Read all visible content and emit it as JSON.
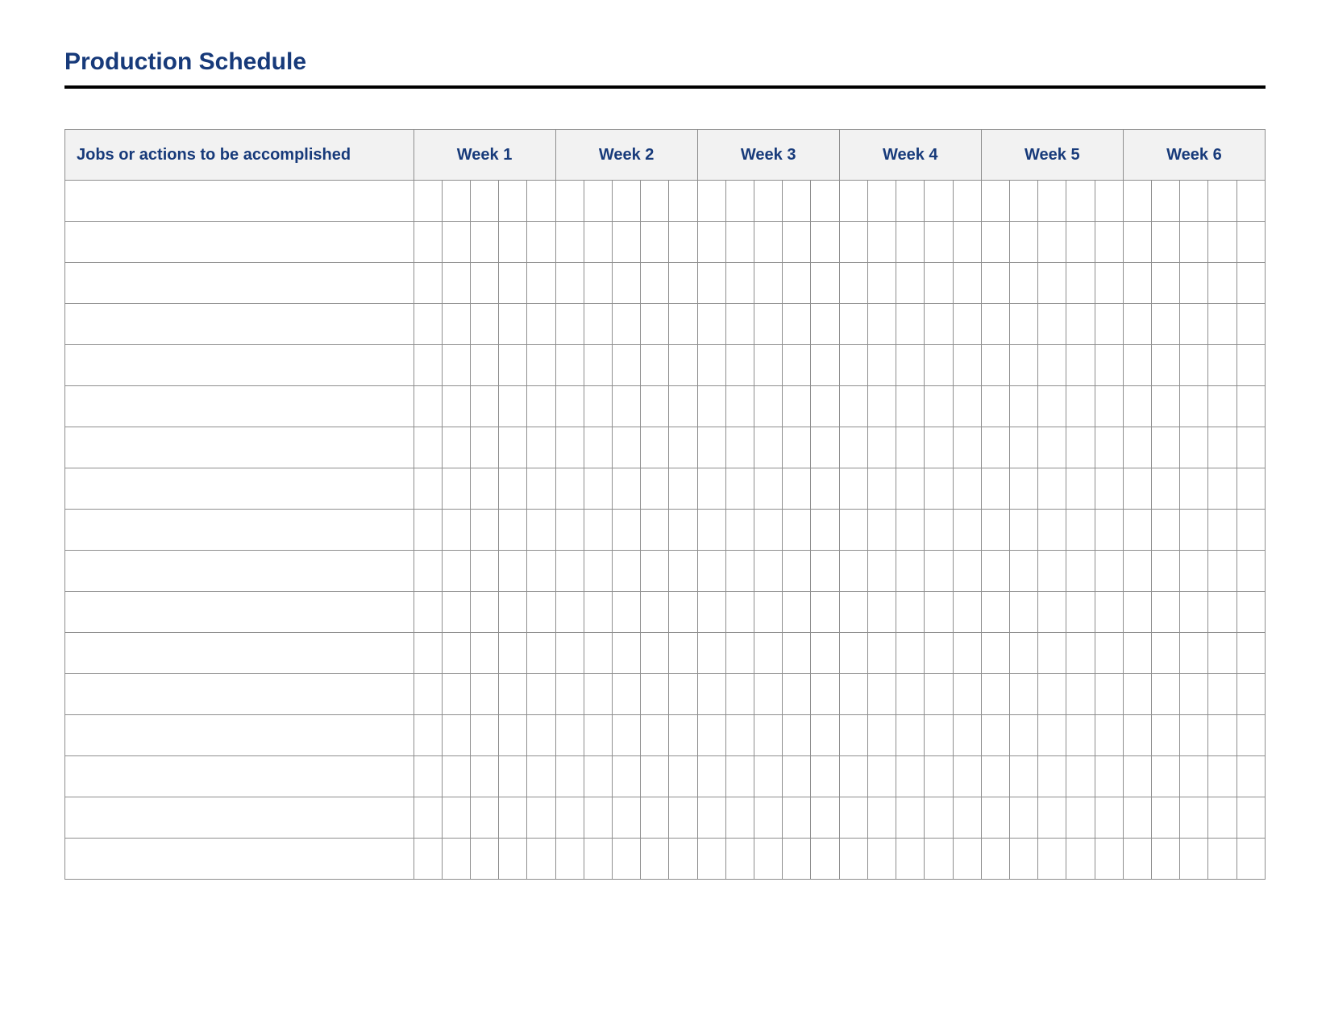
{
  "title": "Production Schedule",
  "headers": {
    "jobs": "Jobs or actions to be accomplished",
    "weeks": [
      "Week 1",
      "Week 2",
      "Week 3",
      "Week 4",
      "Week 5",
      "Week 6"
    ]
  },
  "days_per_week": 5,
  "rows": [
    "",
    "",
    "",
    "",
    "",
    "",
    "",
    "",
    "",
    "",
    "",
    "",
    "",
    "",
    "",
    "",
    ""
  ],
  "colors": {
    "heading": "#173a7a",
    "header_bg": "#f2f2f2",
    "grid": "#8e8e8e",
    "rule": "#000000"
  }
}
